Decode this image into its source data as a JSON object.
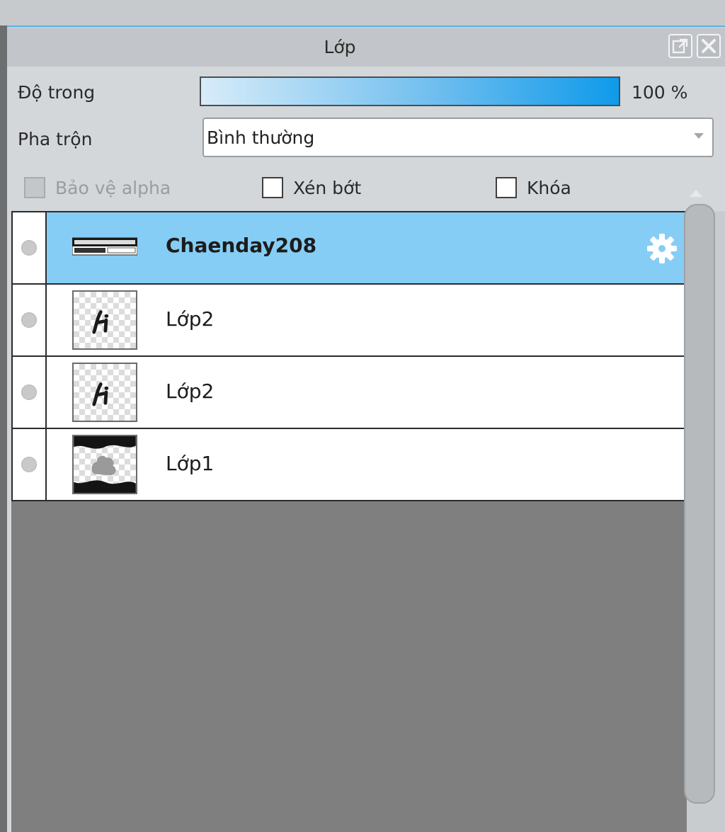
{
  "panel": {
    "title": "Lớp"
  },
  "opacity": {
    "label": "Độ trong",
    "value": "100 %",
    "fraction": 1.0
  },
  "blend": {
    "label": "Pha trộn",
    "value": "Bình thường"
  },
  "checkboxes": {
    "protect_alpha": "Bảo vệ alpha",
    "clipping": "Xén bớt",
    "lock": "Khóa"
  },
  "layers": [
    {
      "name": "Chaenday208",
      "selected": true,
      "thumb": "text-folder-thumbnail"
    },
    {
      "name": "Lớp2",
      "selected": false,
      "thumb": "li-thumbnail"
    },
    {
      "name": "Lớp2",
      "selected": false,
      "thumb": "li-thumbnail"
    },
    {
      "name": "Lớp1",
      "selected": false,
      "thumb": "frame-thumbnail"
    }
  ],
  "colors": {
    "accent": "#0f9aea",
    "selected_row": "#86cdf5",
    "empty_area": "#7f7f7f"
  },
  "icons": {
    "popout": "popout-icon",
    "close": "close-icon",
    "settings": "gear-icon",
    "visibility": "visibility-dot-icon"
  }
}
